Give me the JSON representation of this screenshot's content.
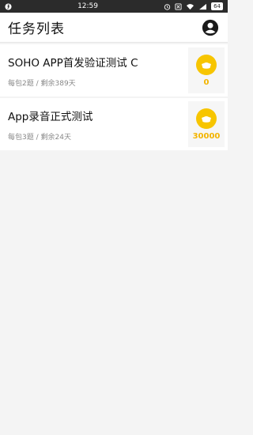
{
  "status": {
    "time": "12:59",
    "battery": "64"
  },
  "header": {
    "title": "任务列表",
    "profile_icon": "account-circle-icon"
  },
  "tasks": [
    {
      "title": "SOHO APP首发验证测试 C",
      "per_pack": "每包2题",
      "separator": " / ",
      "remaining": "剩余389天",
      "reward": "0"
    },
    {
      "title": "App录音正式测试",
      "per_pack": "每包3题",
      "separator": " / ",
      "remaining": "剩余24天",
      "reward": "30000"
    }
  ],
  "colors": {
    "accent": "#f3b400",
    "coin": "#f7c500"
  }
}
